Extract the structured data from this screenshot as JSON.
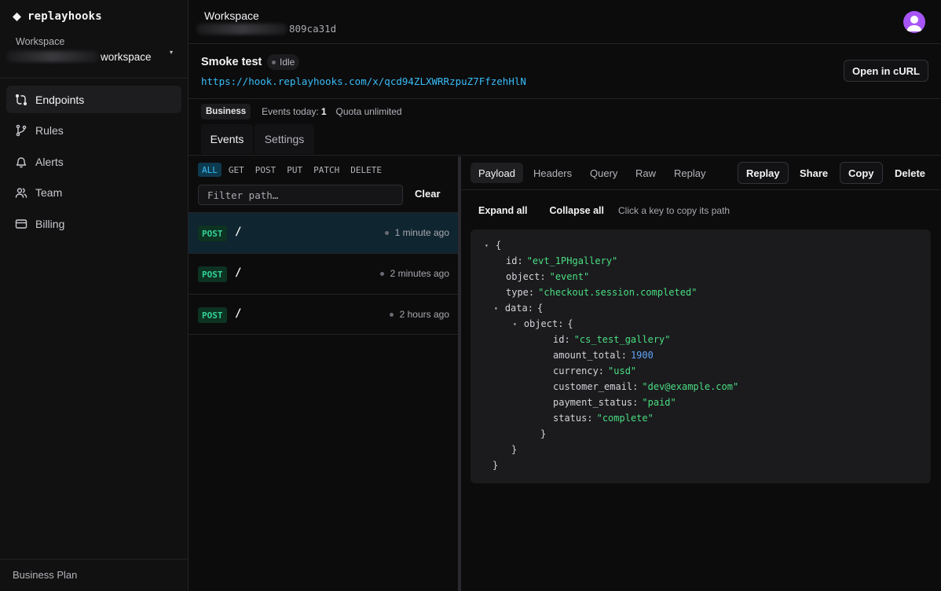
{
  "brand": {
    "name": "replayhooks"
  },
  "sidebar": {
    "workspace_label": "Workspace",
    "workspace_name": "workspace",
    "nav": [
      {
        "label": "Endpoints",
        "icon": "endpoints-icon"
      },
      {
        "label": "Rules",
        "icon": "branch-icon"
      },
      {
        "label": "Alerts",
        "icon": "bell-icon"
      },
      {
        "label": "Team",
        "icon": "users-icon"
      },
      {
        "label": "Billing",
        "icon": "card-icon"
      }
    ],
    "plan": "Business Plan"
  },
  "topbar": {
    "title": "Workspace",
    "workspace_id_suffix": "809ca31d",
    "avatar_color": "#a855f7"
  },
  "endpoint": {
    "name": "Smoke test",
    "status": "Idle",
    "url": "https://hook.replayhooks.com/x/qcd94ZLXWRRzpuZ7FfzehHlN",
    "open_curl_label": "Open in cURL"
  },
  "plan_row": {
    "badge": "Business",
    "events_today_label": "Events today:",
    "events_today_value": "1",
    "quota": "Quota unlimited"
  },
  "tabs": [
    "Events",
    "Settings"
  ],
  "event_list": {
    "methods": [
      "ALL",
      "GET",
      "POST",
      "PUT",
      "PATCH",
      "DELETE"
    ],
    "active_method": "ALL",
    "filter_placeholder": "Filter path…",
    "clear_label": "Clear",
    "rows": [
      {
        "method": "POST",
        "path": "/",
        "time": "1 minute ago"
      },
      {
        "method": "POST",
        "path": "/",
        "time": "2 minutes ago"
      },
      {
        "method": "POST",
        "path": "/",
        "time": "2 hours ago"
      }
    ]
  },
  "detail": {
    "tabs": [
      "Payload",
      "Headers",
      "Query",
      "Raw",
      "Replay"
    ],
    "active_tab": "Payload",
    "actions": [
      "Replay",
      "Share",
      "Copy",
      "Delete"
    ],
    "expand_all": "Expand all",
    "collapse_all": "Collapse all",
    "hint": "Click a key to copy its path",
    "json": {
      "id": "\"evt_1PHgallery\"",
      "object": "\"event\"",
      "type": "\"checkout.session.completed\"",
      "data_object": {
        "id": "\"cs_test_gallery\"",
        "amount_total": "1900",
        "currency": "\"usd\"",
        "customer_email": "\"dev@example.com\"",
        "payment_status": "\"paid\"",
        "status": "\"complete\""
      }
    }
  },
  "colors": {
    "accent": "#38bdf8",
    "post_badge": "#34d399",
    "json_string": "#4ade80",
    "json_number": "#60a5fa"
  }
}
